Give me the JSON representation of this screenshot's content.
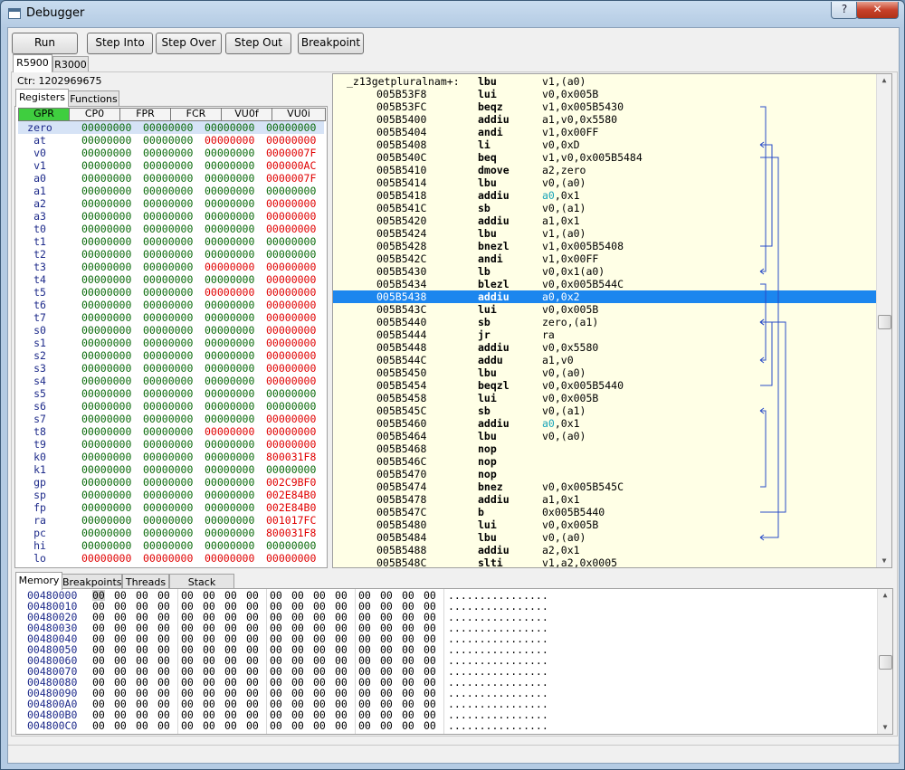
{
  "window": {
    "title": "Debugger",
    "help_label": "?",
    "close_label": "✕"
  },
  "toolbar": {
    "run": "Run",
    "step_into": "Step Into",
    "step_over": "Step Over",
    "step_out": "Step Out",
    "breakpoint": "Breakpoint"
  },
  "cpu_tabs": [
    "R5900",
    "R3000"
  ],
  "counter": "Ctr:  1202969675",
  "left_tabs": [
    "Registers",
    "Functions"
  ],
  "reg_tabs": [
    "GPR",
    "CP0",
    "FPR",
    "FCR",
    "VU0f",
    "VU0i"
  ],
  "registers": [
    {
      "name": "zero",
      "w": [
        "00000000",
        "00000000",
        "00000000",
        "00000000"
      ],
      "c": [
        "g",
        "g",
        "g",
        "g"
      ]
    },
    {
      "name": "at",
      "w": [
        "00000000",
        "00000000",
        "00000000",
        "00000000"
      ],
      "c": [
        "g",
        "g",
        "r",
        "r"
      ]
    },
    {
      "name": "v0",
      "w": [
        "00000000",
        "00000000",
        "00000000",
        "0000007F"
      ],
      "c": [
        "g",
        "g",
        "g",
        "r"
      ]
    },
    {
      "name": "v1",
      "w": [
        "00000000",
        "00000000",
        "00000000",
        "000000AC"
      ],
      "c": [
        "g",
        "g",
        "g",
        "r"
      ]
    },
    {
      "name": "a0",
      "w": [
        "00000000",
        "00000000",
        "00000000",
        "0000007F"
      ],
      "c": [
        "g",
        "g",
        "g",
        "r"
      ]
    },
    {
      "name": "a1",
      "w": [
        "00000000",
        "00000000",
        "00000000",
        "00000000"
      ],
      "c": [
        "g",
        "g",
        "g",
        "g"
      ]
    },
    {
      "name": "a2",
      "w": [
        "00000000",
        "00000000",
        "00000000",
        "00000000"
      ],
      "c": [
        "g",
        "g",
        "g",
        "r"
      ]
    },
    {
      "name": "a3",
      "w": [
        "00000000",
        "00000000",
        "00000000",
        "00000000"
      ],
      "c": [
        "g",
        "g",
        "g",
        "r"
      ]
    },
    {
      "name": "t0",
      "w": [
        "00000000",
        "00000000",
        "00000000",
        "00000000"
      ],
      "c": [
        "g",
        "g",
        "g",
        "r"
      ]
    },
    {
      "name": "t1",
      "w": [
        "00000000",
        "00000000",
        "00000000",
        "00000000"
      ],
      "c": [
        "g",
        "g",
        "g",
        "g"
      ]
    },
    {
      "name": "t2",
      "w": [
        "00000000",
        "00000000",
        "00000000",
        "00000000"
      ],
      "c": [
        "g",
        "g",
        "g",
        "g"
      ]
    },
    {
      "name": "t3",
      "w": [
        "00000000",
        "00000000",
        "00000000",
        "00000000"
      ],
      "c": [
        "g",
        "g",
        "r",
        "r"
      ]
    },
    {
      "name": "t4",
      "w": [
        "00000000",
        "00000000",
        "00000000",
        "00000000"
      ],
      "c": [
        "g",
        "g",
        "g",
        "r"
      ]
    },
    {
      "name": "t5",
      "w": [
        "00000000",
        "00000000",
        "00000000",
        "00000000"
      ],
      "c": [
        "g",
        "g",
        "r",
        "r"
      ]
    },
    {
      "name": "t6",
      "w": [
        "00000000",
        "00000000",
        "00000000",
        "00000000"
      ],
      "c": [
        "g",
        "g",
        "g",
        "r"
      ]
    },
    {
      "name": "t7",
      "w": [
        "00000000",
        "00000000",
        "00000000",
        "00000000"
      ],
      "c": [
        "g",
        "g",
        "g",
        "r"
      ]
    },
    {
      "name": "s0",
      "w": [
        "00000000",
        "00000000",
        "00000000",
        "00000000"
      ],
      "c": [
        "g",
        "g",
        "g",
        "r"
      ]
    },
    {
      "name": "s1",
      "w": [
        "00000000",
        "00000000",
        "00000000",
        "00000000"
      ],
      "c": [
        "g",
        "g",
        "g",
        "r"
      ]
    },
    {
      "name": "s2",
      "w": [
        "00000000",
        "00000000",
        "00000000",
        "00000000"
      ],
      "c": [
        "g",
        "g",
        "g",
        "r"
      ]
    },
    {
      "name": "s3",
      "w": [
        "00000000",
        "00000000",
        "00000000",
        "00000000"
      ],
      "c": [
        "g",
        "g",
        "g",
        "r"
      ]
    },
    {
      "name": "s4",
      "w": [
        "00000000",
        "00000000",
        "00000000",
        "00000000"
      ],
      "c": [
        "g",
        "g",
        "g",
        "r"
      ]
    },
    {
      "name": "s5",
      "w": [
        "00000000",
        "00000000",
        "00000000",
        "00000000"
      ],
      "c": [
        "g",
        "g",
        "g",
        "g"
      ]
    },
    {
      "name": "s6",
      "w": [
        "00000000",
        "00000000",
        "00000000",
        "00000000"
      ],
      "c": [
        "g",
        "g",
        "g",
        "g"
      ]
    },
    {
      "name": "s7",
      "w": [
        "00000000",
        "00000000",
        "00000000",
        "00000000"
      ],
      "c": [
        "g",
        "g",
        "g",
        "r"
      ]
    },
    {
      "name": "t8",
      "w": [
        "00000000",
        "00000000",
        "00000000",
        "00000000"
      ],
      "c": [
        "g",
        "g",
        "r",
        "r"
      ]
    },
    {
      "name": "t9",
      "w": [
        "00000000",
        "00000000",
        "00000000",
        "00000000"
      ],
      "c": [
        "g",
        "g",
        "g",
        "r"
      ]
    },
    {
      "name": "k0",
      "w": [
        "00000000",
        "00000000",
        "00000000",
        "800031F8"
      ],
      "c": [
        "g",
        "g",
        "g",
        "r"
      ]
    },
    {
      "name": "k1",
      "w": [
        "00000000",
        "00000000",
        "00000000",
        "00000000"
      ],
      "c": [
        "g",
        "g",
        "g",
        "g"
      ]
    },
    {
      "name": "gp",
      "w": [
        "00000000",
        "00000000",
        "00000000",
        "002C9BF0"
      ],
      "c": [
        "g",
        "g",
        "g",
        "r"
      ]
    },
    {
      "name": "sp",
      "w": [
        "00000000",
        "00000000",
        "00000000",
        "002E84B0"
      ],
      "c": [
        "g",
        "g",
        "g",
        "r"
      ]
    },
    {
      "name": "fp",
      "w": [
        "00000000",
        "00000000",
        "00000000",
        "002E84B0"
      ],
      "c": [
        "g",
        "g",
        "g",
        "r"
      ]
    },
    {
      "name": "ra",
      "w": [
        "00000000",
        "00000000",
        "00000000",
        "001017FC"
      ],
      "c": [
        "g",
        "g",
        "g",
        "r"
      ]
    },
    {
      "name": "pc",
      "w": [
        "00000000",
        "00000000",
        "00000000",
        "800031F8"
      ],
      "c": [
        "g",
        "g",
        "g",
        "r"
      ]
    },
    {
      "name": "hi",
      "w": [
        "00000000",
        "00000000",
        "00000000",
        "00000000"
      ],
      "c": [
        "g",
        "g",
        "g",
        "g"
      ]
    },
    {
      "name": "lo",
      "w": [
        "00000000",
        "00000000",
        "00000000",
        "00000000"
      ],
      "c": [
        "r",
        "r",
        "r",
        "r"
      ]
    }
  ],
  "disassembly": [
    {
      "addr": "_z13getpluralnam+:",
      "op": "lbu",
      "args": "v1,(a0)",
      "label": true
    },
    {
      "addr": "005B53F8",
      "op": "lui",
      "args": "v0,0x005B"
    },
    {
      "addr": "005B53FC",
      "op": "beqz",
      "args": "v1,0x005B5430"
    },
    {
      "addr": "005B5400",
      "op": "addiu",
      "args": "a1,v0,0x5580"
    },
    {
      "addr": "005B5404",
      "op": "andi",
      "args": "v1,0x00FF"
    },
    {
      "addr": "005B5408",
      "op": "li",
      "args": "v0,0xD"
    },
    {
      "addr": "005B540C",
      "op": "beq",
      "args": "v1,v0,0x005B5484"
    },
    {
      "addr": "005B5410",
      "op": "dmove",
      "args": "a2,zero"
    },
    {
      "addr": "005B5414",
      "op": "lbu",
      "args": "v0,(a0)"
    },
    {
      "addr": "005B5418",
      "op": "addiu",
      "args": "a0,0x1",
      "hl": "a0"
    },
    {
      "addr": "005B541C",
      "op": "sb",
      "args": "v0,(a1)"
    },
    {
      "addr": "005B5420",
      "op": "addiu",
      "args": "a1,0x1"
    },
    {
      "addr": "005B5424",
      "op": "lbu",
      "args": "v1,(a0)"
    },
    {
      "addr": "005B5428",
      "op": "bnezl",
      "args": "v1,0x005B5408"
    },
    {
      "addr": "005B542C",
      "op": "andi",
      "args": "v1,0x00FF"
    },
    {
      "addr": "005B5430",
      "op": "lb",
      "args": "v0,0x1(a0)"
    },
    {
      "addr": "005B5434",
      "op": "blezl",
      "args": "v0,0x005B544C"
    },
    {
      "addr": "005B5438",
      "op": "addiu",
      "args": "a0,0x2",
      "sel": true
    },
    {
      "addr": "005B543C",
      "op": "lui",
      "args": "v0,0x005B"
    },
    {
      "addr": "005B5440",
      "op": "sb",
      "args": "zero,(a1)"
    },
    {
      "addr": "005B5444",
      "op": "jr",
      "args": "ra"
    },
    {
      "addr": "005B5448",
      "op": "addiu",
      "args": "v0,0x5580"
    },
    {
      "addr": "005B544C",
      "op": "addu",
      "args": "a1,v0"
    },
    {
      "addr": "005B5450",
      "op": "lbu",
      "args": "v0,(a0)"
    },
    {
      "addr": "005B5454",
      "op": "beqzl",
      "args": "v0,0x005B5440"
    },
    {
      "addr": "005B5458",
      "op": "lui",
      "args": "v0,0x005B"
    },
    {
      "addr": "005B545C",
      "op": "sb",
      "args": "v0,(a1)"
    },
    {
      "addr": "005B5460",
      "op": "addiu",
      "args": "a0,0x1",
      "hl": "a0"
    },
    {
      "addr": "005B5464",
      "op": "lbu",
      "args": "v0,(a0)"
    },
    {
      "addr": "005B5468",
      "op": "nop",
      "args": ""
    },
    {
      "addr": "005B546C",
      "op": "nop",
      "args": ""
    },
    {
      "addr": "005B5470",
      "op": "nop",
      "args": ""
    },
    {
      "addr": "005B5474",
      "op": "bnez",
      "args": "v0,0x005B545C"
    },
    {
      "addr": "005B5478",
      "op": "addiu",
      "args": "a1,0x1"
    },
    {
      "addr": "005B547C",
      "op": "b",
      "args": "0x005B5440"
    },
    {
      "addr": "005B5480",
      "op": "lui",
      "args": "v0,0x005B"
    },
    {
      "addr": "005B5484",
      "op": "lbu",
      "args": "v0,(a0)"
    },
    {
      "addr": "005B5488",
      "op": "addiu",
      "args": "a2,0x1"
    },
    {
      "addr": "005B548C",
      "op": "slti",
      "args": "v1,a2,0x0005"
    }
  ],
  "bottom_tabs": [
    "Memory",
    "Breakpoints",
    "Threads",
    "Stack frames"
  ],
  "memory": {
    "addresses": [
      "00480000",
      "00480010",
      "00480020",
      "00480030",
      "00480040",
      "00480050",
      "00480060",
      "00480070",
      "00480080",
      "00480090",
      "004800A0",
      "004800B0",
      "004800C0"
    ],
    "byte": "00",
    "ascii": "................"
  },
  "colors": {
    "register_changed": "#e00000",
    "register_value": "#0a6a0a",
    "register_name": "#1d2a8a",
    "disasm_bg": "#ffffe6",
    "selection": "#1c86ee",
    "branch_arrow": "#2a4cc8"
  }
}
